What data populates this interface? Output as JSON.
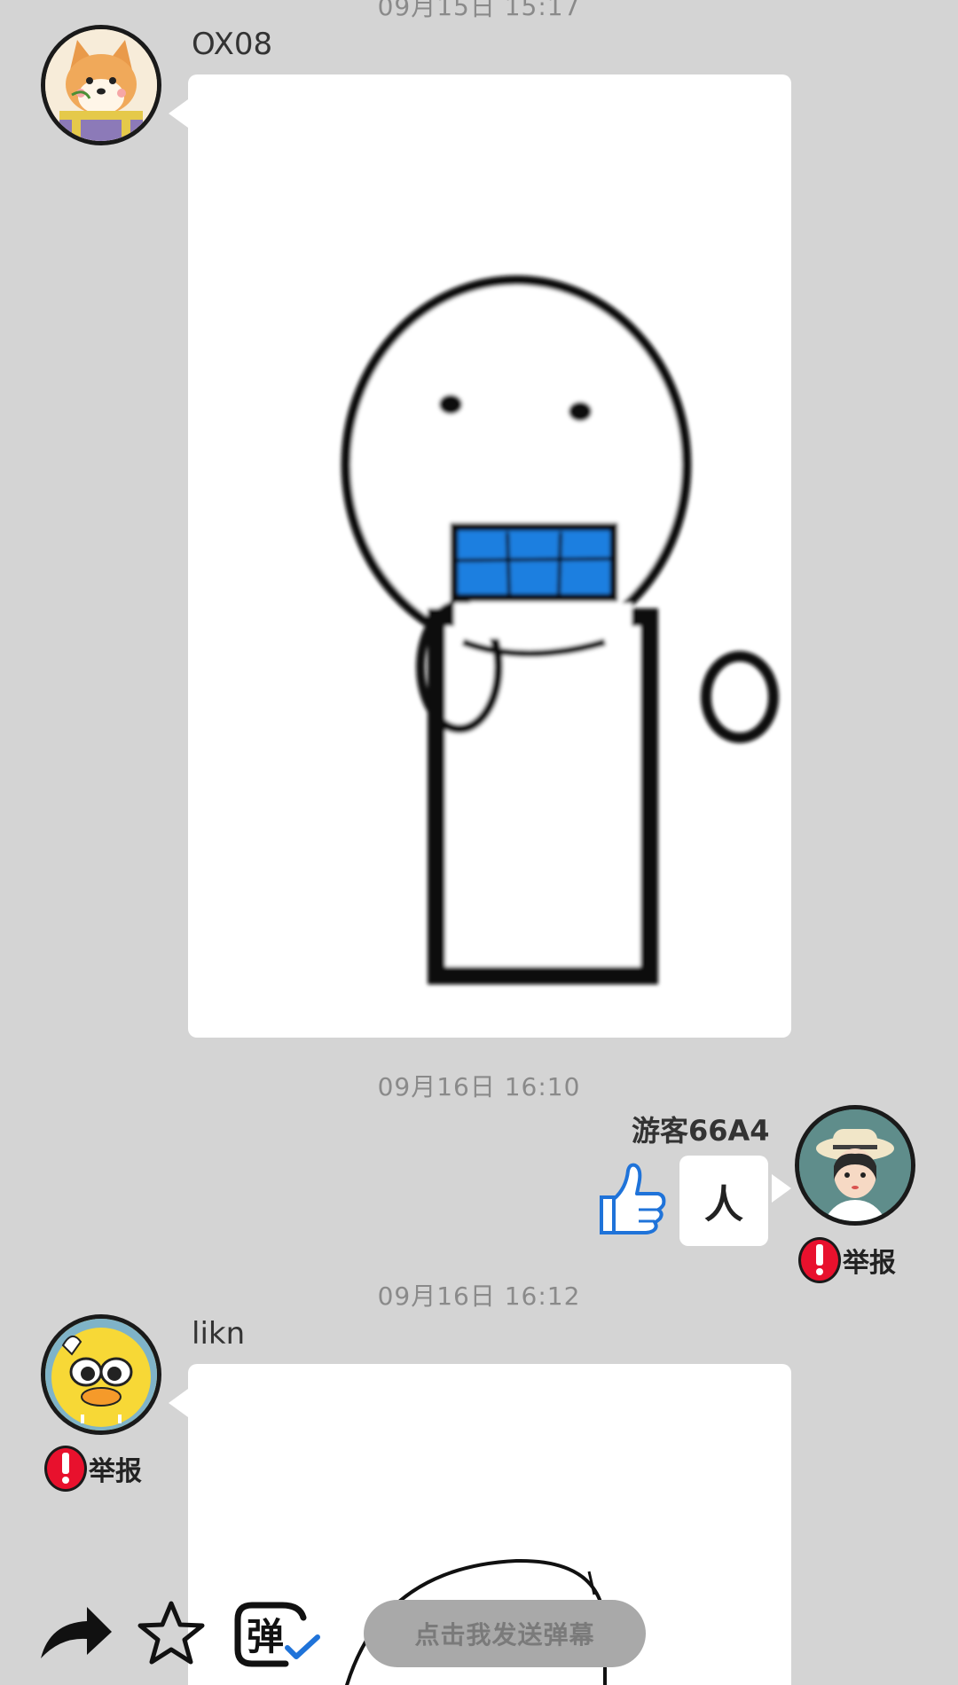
{
  "messages": [
    {
      "timestamp": "09月15日 15:17",
      "username": "OX08",
      "avatar_icon": "shiba-dog-avatar",
      "content_type": "image",
      "image_icon": "stickman-bathroom-sticker"
    },
    {
      "timestamp": "09月16日 16:10",
      "username": "游客66A4",
      "avatar_icon": "girl-with-hat-avatar",
      "content_type": "text",
      "text": "人",
      "reaction_icon": "thumbs-up-icon",
      "report_label": "举报"
    },
    {
      "timestamp": "09月16日 16:12",
      "username": "likn",
      "avatar_icon": "yellow-duck-avatar",
      "content_type": "image",
      "image_icon": "stickman-sticker",
      "report_label": "举报"
    }
  ],
  "toolbar": {
    "share_icon": "share-arrow-icon",
    "favorite_icon": "star-icon",
    "danmaku_icon": "danmaku-toggle-icon",
    "danmaku_glyph": "弹",
    "danmaku_placeholder": "点击我发送弹幕"
  },
  "colors": {
    "background": "#d4d4d4",
    "bubble": "#ffffff",
    "report_red": "#e8112d",
    "accent_blue": "#1f73d9"
  }
}
